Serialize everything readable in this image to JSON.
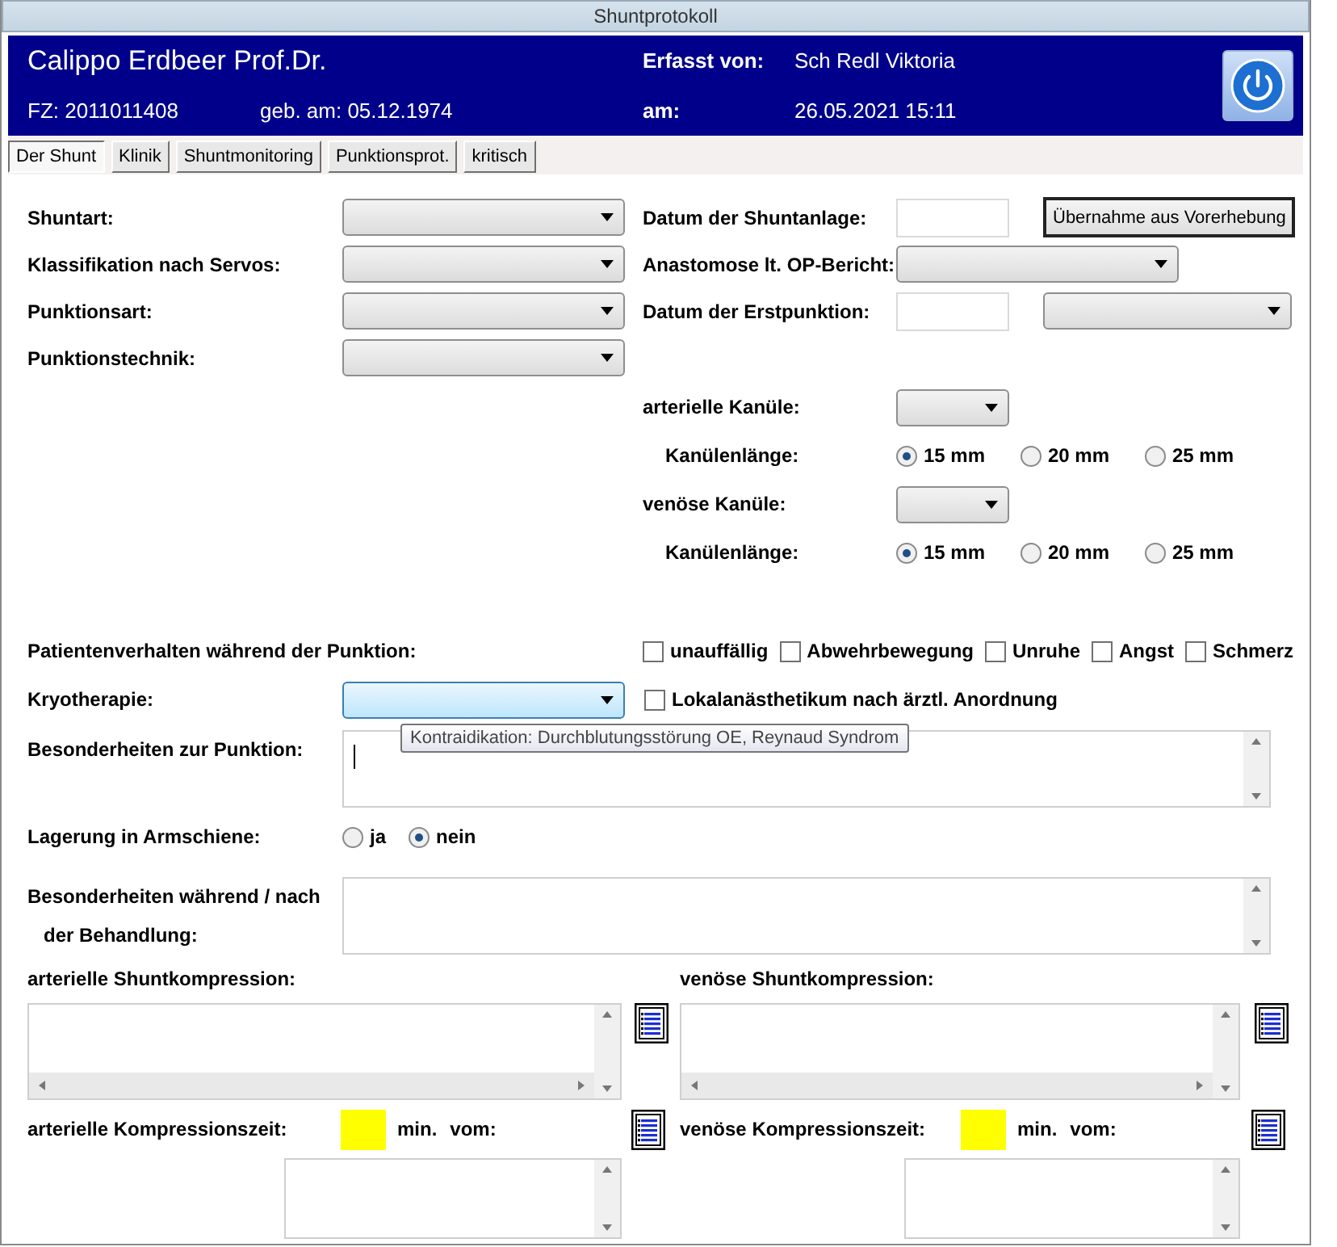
{
  "window": {
    "title": "Shuntprotokoll"
  },
  "header": {
    "patient_name": "Calippo Erdbeer Prof.Dr.",
    "fz": "FZ: 2011011408",
    "birth": "geb. am: 05.12.1974",
    "recorded_by_label": "Erfasst von:",
    "recorded_by": "Sch Redl Viktoria",
    "date_label": "am:",
    "date": "26.05.2021 15:11"
  },
  "tabs": [
    {
      "label": "Der Shunt",
      "selected": true
    },
    {
      "label": "Klinik",
      "selected": false
    },
    {
      "label": "Shuntmonitoring",
      "selected": false
    },
    {
      "label": "Punktionsprot.",
      "selected": false
    },
    {
      "label": "kritisch",
      "selected": false
    }
  ],
  "shunt_fields": [
    {
      "label": "Shuntart:"
    },
    {
      "label": "Klassifikation nach Servos:"
    },
    {
      "label": "Punktionsart:"
    },
    {
      "label": "Punktionstechnik:"
    }
  ],
  "shunt_date": {
    "label": "Datum der Shuntanlage:",
    "button": "Übernahme aus Vorerhebung"
  },
  "anastomose": {
    "label": "Anastomose lt. OP-Bericht:"
  },
  "first_puncture": {
    "label": "Datum der Erstpunktion:"
  },
  "cannulas": [
    {
      "label": "arterielle Kanüle:",
      "length_label": "Kanülenlänge:",
      "lengths": [
        {
          "label": "15 mm",
          "selected": true
        },
        {
          "label": "20 mm",
          "selected": false
        },
        {
          "label": "25 mm",
          "selected": false
        }
      ]
    },
    {
      "label": "venöse Kanüle:",
      "length_label": "Kanülenlänge:",
      "lengths": [
        {
          "label": "15 mm",
          "selected": true
        },
        {
          "label": "20 mm",
          "selected": false
        },
        {
          "label": "25 mm",
          "selected": false
        }
      ]
    }
  ],
  "behavior": {
    "label": "Patientenverhalten während der Punktion:",
    "options": [
      {
        "label": "unauffällig",
        "checked": false
      },
      {
        "label": "Abwehrbewegung",
        "checked": false
      },
      {
        "label": "Unruhe",
        "checked": false
      },
      {
        "label": "Angst",
        "checked": false
      },
      {
        "label": "Schmerz",
        "checked": false
      }
    ]
  },
  "cryotherapy": {
    "label": "Kryotherapie:",
    "focused": true,
    "option": {
      "label": "Lokalanästhetikum nach ärztl. Anordnung",
      "checked": false
    }
  },
  "puncture_notes": {
    "label": "Besonderheiten zur Punktion:",
    "tooltip": "Kontraidikation: Durchblutungsstörung OE, Reynaud Syndrom"
  },
  "arm_splint": {
    "label": "Lagerung in Armschiene:",
    "options": [
      {
        "label": "ja",
        "selected": false
      },
      {
        "label": "nein",
        "selected": true
      }
    ]
  },
  "treatment_notes": {
    "label_lines": [
      "Besonderheiten während / nach",
      "der Behandlung:"
    ]
  },
  "compression": [
    {
      "label": "arterielle Shuntkompression:",
      "time_label": "arterielle Kompressionszeit:",
      "unit": "min.",
      "from": "vom:"
    },
    {
      "label": "venöse Shuntkompression:",
      "time_label": "venöse Kompressionszeit:",
      "unit": "min.",
      "from": "vom:"
    }
  ]
}
